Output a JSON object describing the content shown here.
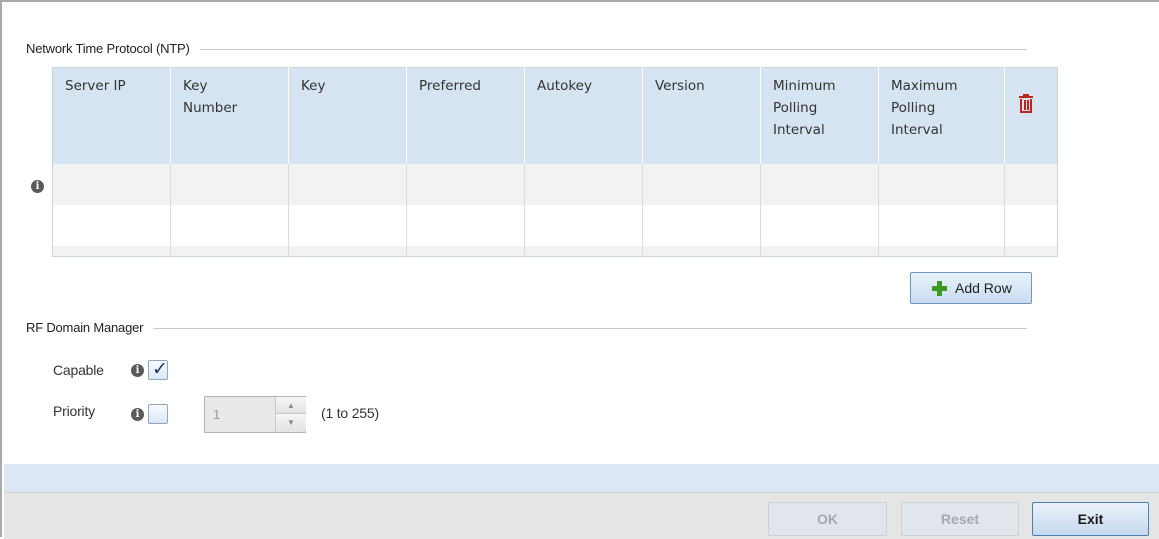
{
  "ntp": {
    "title": "Network Time Protocol (NTP)",
    "columns": [
      {
        "line1": "Server IP",
        "line2": "",
        "line3": ""
      },
      {
        "line1": "Key",
        "line2": "Number",
        "line3": ""
      },
      {
        "line1": "Key",
        "line2": "",
        "line3": ""
      },
      {
        "line1": "Preferred",
        "line2": "",
        "line3": ""
      },
      {
        "line1": "Autokey",
        "line2": "",
        "line3": ""
      },
      {
        "line1": "Version",
        "line2": "",
        "line3": ""
      },
      {
        "line1": "Minimum",
        "line2": "Polling",
        "line3": "Interval"
      },
      {
        "line1": "Maximum",
        "line2": "Polling",
        "line3": "Interval"
      }
    ],
    "delete_icon": "trash-icon",
    "info_icon": "info-icon",
    "add_row_label": "Add Row",
    "add_row_icon": "plus-icon"
  },
  "rf_domain_manager": {
    "title": "RF Domain Manager",
    "capable_label": "Capable",
    "capable_checked": true,
    "priority_label": "Priority",
    "priority_checked": false,
    "priority_value": "1",
    "priority_range": "(1 to 255)"
  },
  "footer": {
    "ok_label": "OK",
    "reset_label": "Reset",
    "exit_label": "Exit"
  },
  "colors": {
    "header_bg": "#d6e4f2",
    "delete_red": "#c0221c",
    "add_green": "#3a9a1e",
    "band_blue": "#dbe7f3"
  }
}
